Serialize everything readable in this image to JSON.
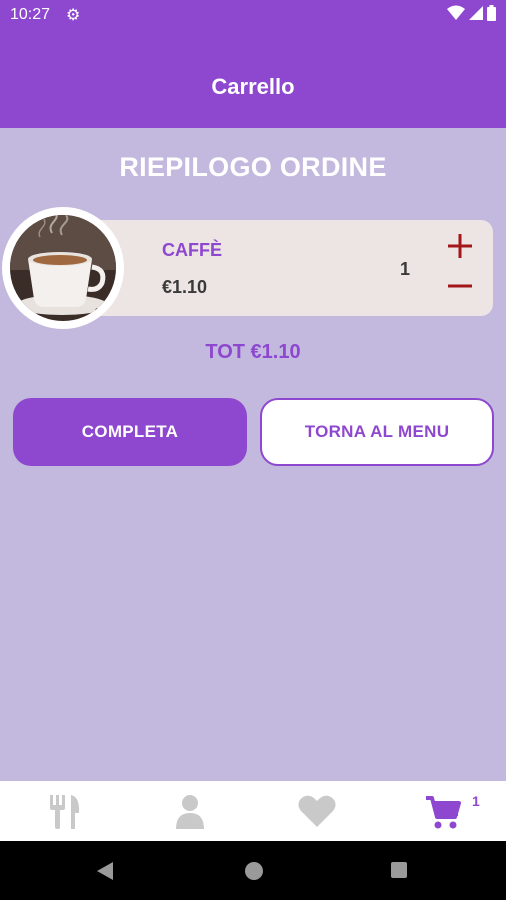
{
  "status_bar": {
    "time": "10:27"
  },
  "app_bar": {
    "title": "Carrello"
  },
  "summary": {
    "title": "RIEPILOGO ORDINE"
  },
  "cart_items": [
    {
      "name": "CAFFÈ",
      "price": "€1.10",
      "quantity": "1"
    }
  ],
  "total": "TOT €1.10",
  "actions": {
    "complete": "COMPLETA",
    "back_to_menu": "TORNA AL MENU"
  },
  "bottom_nav": {
    "cart_badge": "1"
  },
  "colors": {
    "primary": "#8e47cf",
    "background": "#c3b8de",
    "card": "#ede5e3",
    "accent_red": "#a3161a"
  }
}
